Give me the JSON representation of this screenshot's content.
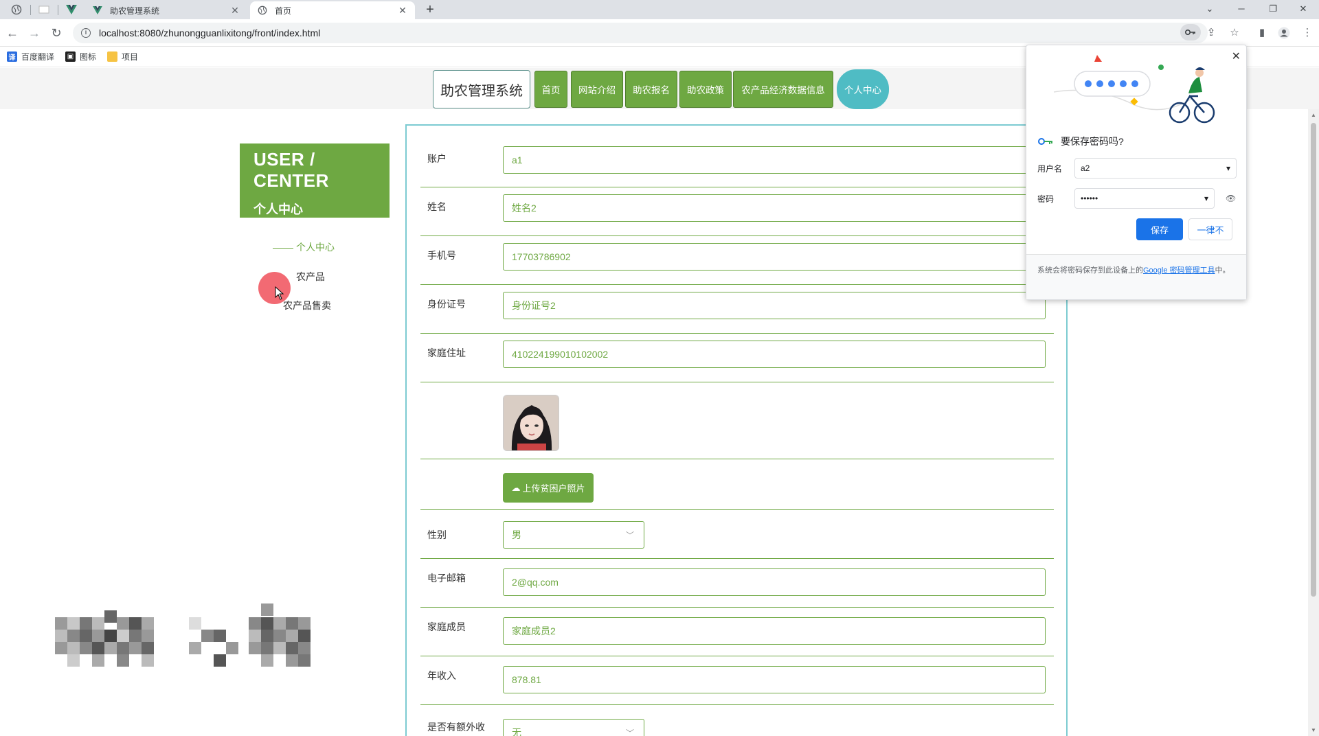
{
  "browser": {
    "tabs": [
      {
        "title": "助农管理系统",
        "active": false
      },
      {
        "title": "首页",
        "active": true
      }
    ],
    "address": "localhost:8080/zhunongguanlixitong/front/index.html",
    "bookmarks": [
      "百度翻译",
      "图标",
      "项目"
    ]
  },
  "nav": {
    "brand": "助农管理系统",
    "items": [
      "首页",
      "网站介绍",
      "助农报名",
      "助农政策",
      "农产品经济数据信息",
      "个人中心"
    ],
    "active_index": 5
  },
  "sidebar": {
    "title_en": "USER / CENTER",
    "title_cn": "个人中心",
    "links": [
      "个人中心",
      "农产品",
      "农产品售卖"
    ]
  },
  "form": {
    "account_label": "账户",
    "account_value": "a1",
    "name_label": "姓名",
    "name_value": "姓名2",
    "phone_label": "手机号",
    "phone_value": "17703786902",
    "idcard_label": "身份证号",
    "idcard_value": "身份证号2",
    "address_label": "家庭住址",
    "address_value": "410224199010102002",
    "upload_label": "上传贫困户照片",
    "gender_label": "性别",
    "gender_value": "男",
    "email_label": "电子邮箱",
    "email_value": "2@qq.com",
    "family_label": "家庭成员",
    "family_value": "家庭成员2",
    "income_label": "年收入",
    "income_value": "878.81",
    "extra_label": "是否有额外收",
    "extra_value": "无"
  },
  "password_prompt": {
    "title": "要保存密码吗?",
    "username_label": "用户名",
    "username_value": "a2",
    "password_label": "密码",
    "password_value": "••••••",
    "save": "保存",
    "never": "一律不",
    "footer_text": "系统会将密码保存到此设备上的",
    "footer_link": "Google 密码管理工具",
    "footer_end": "中。"
  },
  "colors": {
    "accent_green": "#6ea842",
    "active_teal": "#4fbcc4",
    "chrome_blue": "#1a73e8"
  }
}
